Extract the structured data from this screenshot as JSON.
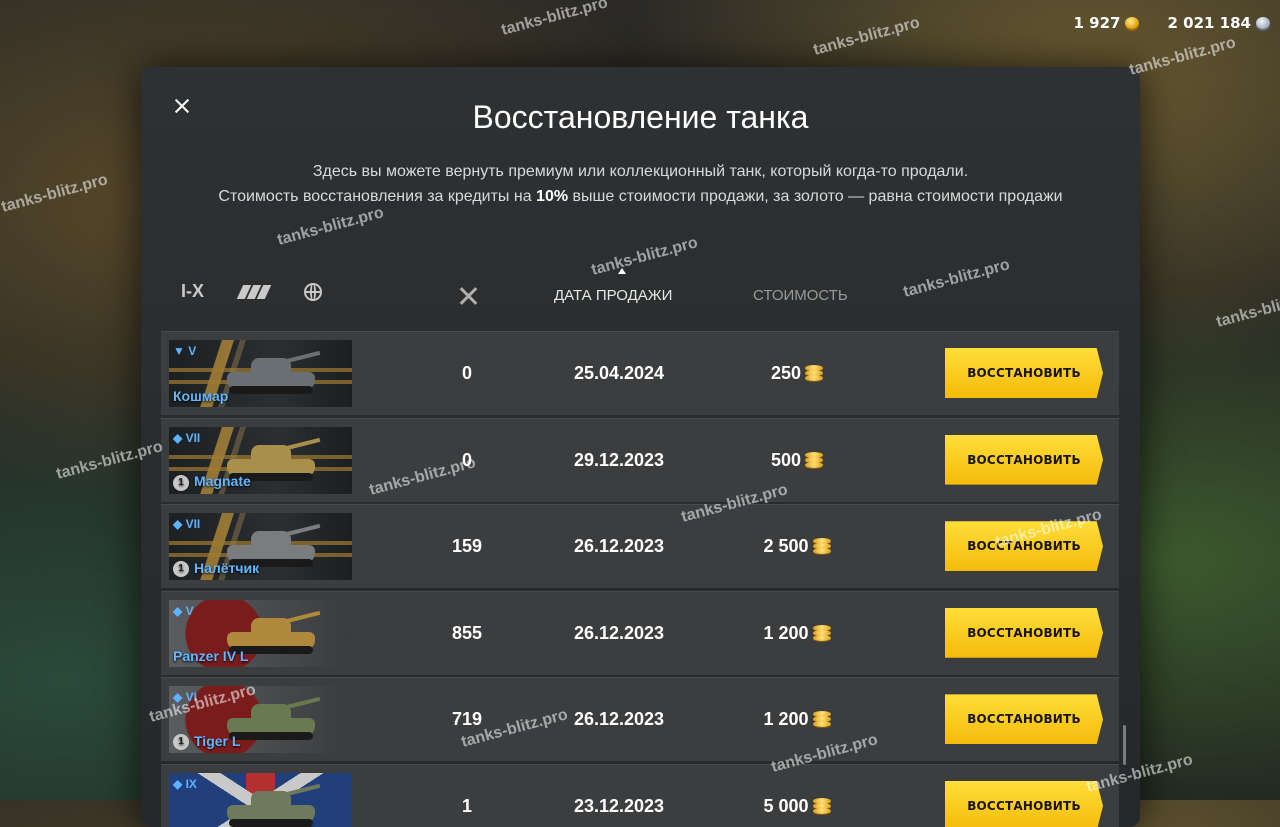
{
  "currencies": {
    "gold": "1 927",
    "credits": "2 021 184",
    "gold_icon": "gold-coin-icon",
    "credits_icon": "silver-coin-icon"
  },
  "dialog": {
    "title": "Восстановление танка",
    "desc_line1": "Здесь вы можете вернуть премиум или коллекционный танк, который когда-то продали.",
    "desc_line2a": "Стоимость восстановления за кредиты на ",
    "desc_line2_bold": "10%",
    "desc_line2b": " выше стоимости продажи, за золото — равна стоимости продажи"
  },
  "filters": {
    "tier_label": "I-X",
    "nation_icon": "nation-filter-icon",
    "type_icon": "globe-icon"
  },
  "columns": {
    "battles_icon": "crossed-swords-icon",
    "date": "ДАТА ПРОДАЖИ",
    "cost": "СТОИМОСТЬ",
    "sorted_by": "date"
  },
  "tanks": [
    {
      "tier": "▼ V",
      "name": "Кошмар",
      "badge": "",
      "battles": "0",
      "date": "25.04.2024",
      "cost": "250",
      "button": "ВОССТАНОВИТЬ",
      "card": "dark",
      "tank_color": "#6a6f74"
    },
    {
      "tier": "◆ VII",
      "name": "Magnate",
      "badge": "1",
      "battles": "0",
      "date": "29.12.2023",
      "cost": "500",
      "button": "ВОССТАНОВИТЬ",
      "card": "dark",
      "tank_color": "#a8904c"
    },
    {
      "tier": "◆ VII",
      "name": "Налётчик",
      "badge": "1",
      "battles": "159",
      "date": "26.12.2023",
      "cost": "2 500",
      "button": "ВОССТАНОВИТЬ",
      "card": "dark",
      "tank_color": "#7a7c7e"
    },
    {
      "tier": "◆ V",
      "name": "Panzer IV L",
      "badge": "",
      "battles": "855",
      "date": "26.12.2023",
      "cost": "1 200",
      "button": "ВОССТАНОВИТЬ",
      "card": "jp",
      "tank_color": "#b08a3c"
    },
    {
      "tier": "◆ VI",
      "name": "Tiger L",
      "badge": "1",
      "battles": "719",
      "date": "26.12.2023",
      "cost": "1 200",
      "button": "ВОССТАНОВИТЬ",
      "card": "jp",
      "tank_color": "#6a7a50"
    },
    {
      "tier": "◆ IX",
      "name": "",
      "badge": "",
      "battles": "1",
      "date": "23.12.2023",
      "cost": "5 000",
      "button": "ВОССТАНОВИТЬ",
      "card": "uk",
      "tank_color": "#6f7a5c"
    }
  ],
  "watermark_text": "tanks-blitz.pro",
  "colors": {
    "accent": "#f4bb0b",
    "tank_name": "#64b6ff",
    "panel": "#2e3133"
  }
}
